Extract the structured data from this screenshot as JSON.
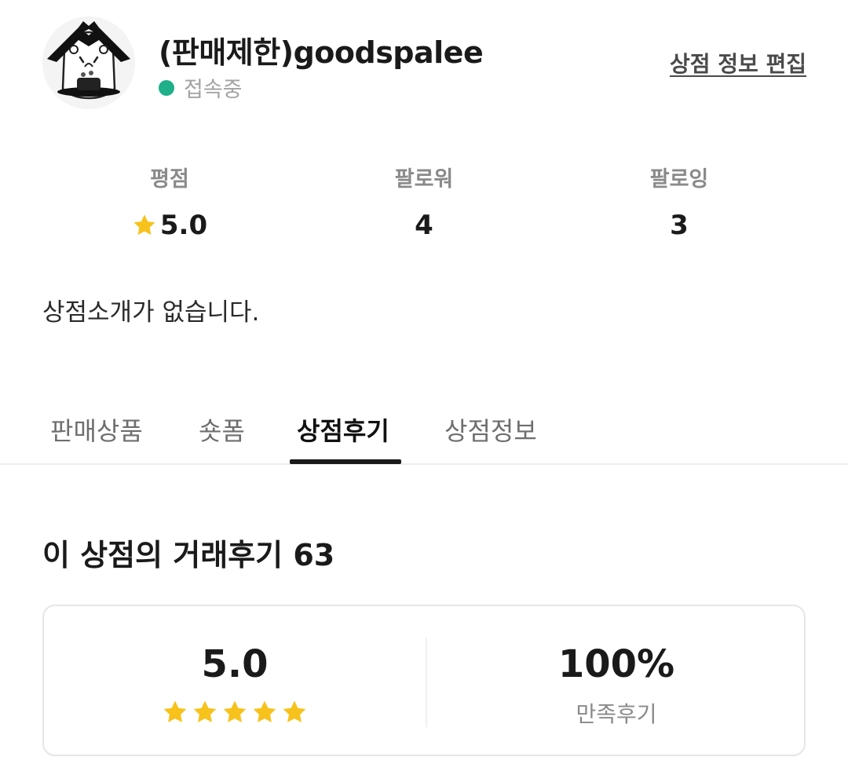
{
  "profile": {
    "shop_name": "(판매제한)goodspalee",
    "status_text": "접속중",
    "edit_label": "상점 정보 편집",
    "avatar_icon": "hamster-avatar-icon"
  },
  "stats": [
    {
      "label": "평점",
      "value": "5.0",
      "icon": "star-icon"
    },
    {
      "label": "팔로워",
      "value": "4"
    },
    {
      "label": "팔로잉",
      "value": "3"
    }
  ],
  "intro_text": "상점소개가 없습니다.",
  "tabs": [
    {
      "label": "판매상품",
      "active": false
    },
    {
      "label": "숏폼",
      "active": false
    },
    {
      "label": "상점후기",
      "active": true
    },
    {
      "label": "상점정보",
      "active": false
    }
  ],
  "reviews": {
    "title": "이 상점의 거래후기 63",
    "rating": "5.0",
    "stars": 5,
    "satisfaction_percent": "100%",
    "satisfaction_label": "만족후기"
  },
  "colors": {
    "online": "#1fb08a",
    "star": "#f7c21b",
    "tab_indicator": "#1a1a1a"
  }
}
